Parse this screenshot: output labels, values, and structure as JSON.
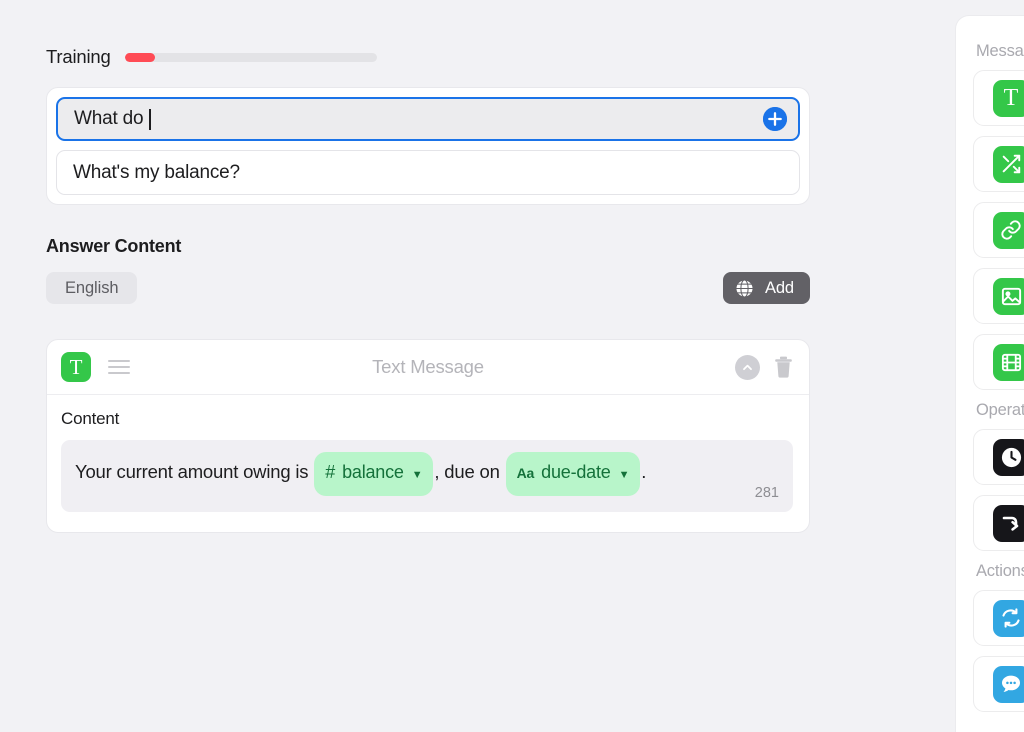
{
  "training": {
    "label": "Training",
    "progress_percent": 12,
    "progress_color": "#ff4b55",
    "phrases": [
      {
        "text": "What do ",
        "focused": true,
        "caret": true
      },
      {
        "text": "What's my balance?",
        "focused": false,
        "caret": false
      }
    ],
    "add_phrase_icon": "plus-circle-icon"
  },
  "answer_content": {
    "title": "Answer Content",
    "language_tabs": [
      {
        "label": "English",
        "selected": true
      }
    ],
    "add_button": {
      "label": "Add",
      "icon": "globe-icon",
      "background": "#626166"
    }
  },
  "message_card": {
    "type_icon": "text-message-icon",
    "type_icon_letter": "T",
    "type_icon_color": "#34c749",
    "drag_handle_icon": "drag-handle-icon",
    "title": "Text Message",
    "collapse_icon": "chevron-up-icon",
    "delete_icon": "trash-icon",
    "content_label": "Content",
    "content_parts": [
      {
        "kind": "text",
        "value": "Your current amount owing is "
      },
      {
        "kind": "token",
        "prefix": "#",
        "prefix_style": "hash",
        "name": "balance",
        "caret": "▼"
      },
      {
        "kind": "text",
        "value": ", due on "
      },
      {
        "kind": "token",
        "prefix": "Aa",
        "prefix_style": "aa",
        "name": "due-date",
        "caret": "▼"
      },
      {
        "kind": "text",
        "value": "."
      }
    ],
    "character_count": "281",
    "token_background": "#b8f5ca",
    "token_text_color": "#14713a"
  },
  "sidebar": {
    "sections": [
      {
        "title": "Messages",
        "items": [
          {
            "icon": "text-message-icon",
            "letter": "T",
            "color": "green"
          },
          {
            "icon": "shuffle-icon",
            "color": "green"
          },
          {
            "icon": "link-chain-icon",
            "color": "green"
          },
          {
            "icon": "image-icon",
            "color": "green"
          },
          {
            "icon": "video-film-icon",
            "color": "green"
          }
        ]
      },
      {
        "title": "Operations",
        "items": [
          {
            "icon": "clock-icon",
            "color": "black"
          },
          {
            "icon": "arrow-right-jump-icon",
            "color": "black"
          }
        ]
      },
      {
        "title": "Actions",
        "items": [
          {
            "icon": "sync-exchange-icon",
            "color": "blue"
          },
          {
            "icon": "chat-bubble-icon",
            "color": "blue"
          }
        ]
      }
    ]
  }
}
